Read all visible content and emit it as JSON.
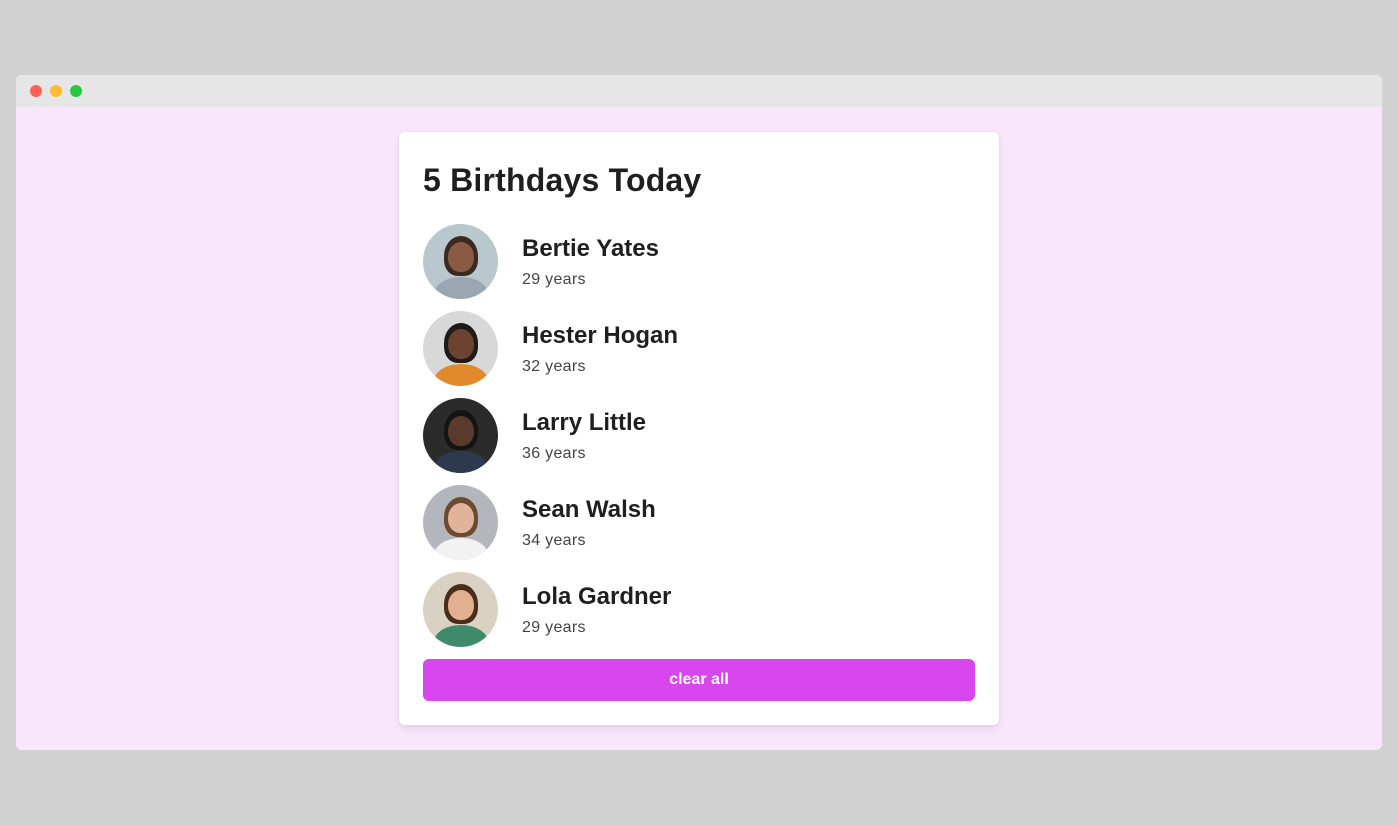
{
  "window": {
    "traffic_lights": [
      "close",
      "minimize",
      "maximize"
    ]
  },
  "card": {
    "title": "5 Birthdays Today",
    "people": [
      {
        "name": "Bertie Yates",
        "age": "29 years",
        "avatar_bg": "#b9c7cf",
        "hair": "#3a2a22",
        "skin": "#8a5a44",
        "shirt": "#9aa7b3"
      },
      {
        "name": "Hester Hogan",
        "age": "32 years",
        "avatar_bg": "#d8d8d8",
        "hair": "#1e1a18",
        "skin": "#6b4330",
        "shirt": "#e08a2c"
      },
      {
        "name": "Larry Little",
        "age": "36 years",
        "avatar_bg": "#2b2b2b",
        "hair": "#141414",
        "skin": "#5a3a2a",
        "shirt": "#2d3a4d"
      },
      {
        "name": "Sean Walsh",
        "age": "34 years",
        "avatar_bg": "#b3b7bb",
        "hair": "#6b4a30",
        "skin": "#e0b39a",
        "shirt": "#f2f2f2"
      },
      {
        "name": "Lola Gardner",
        "age": "29 years",
        "avatar_bg": "#d9d2c3",
        "hair": "#4a2c1a",
        "skin": "#e2b08f",
        "shirt": "#3f8a6a"
      }
    ],
    "clear_label": "clear all"
  },
  "colors": {
    "accent": "#d946ef",
    "page_bg": "#f9e6fd",
    "outer_bg": "#d1d1d1"
  }
}
